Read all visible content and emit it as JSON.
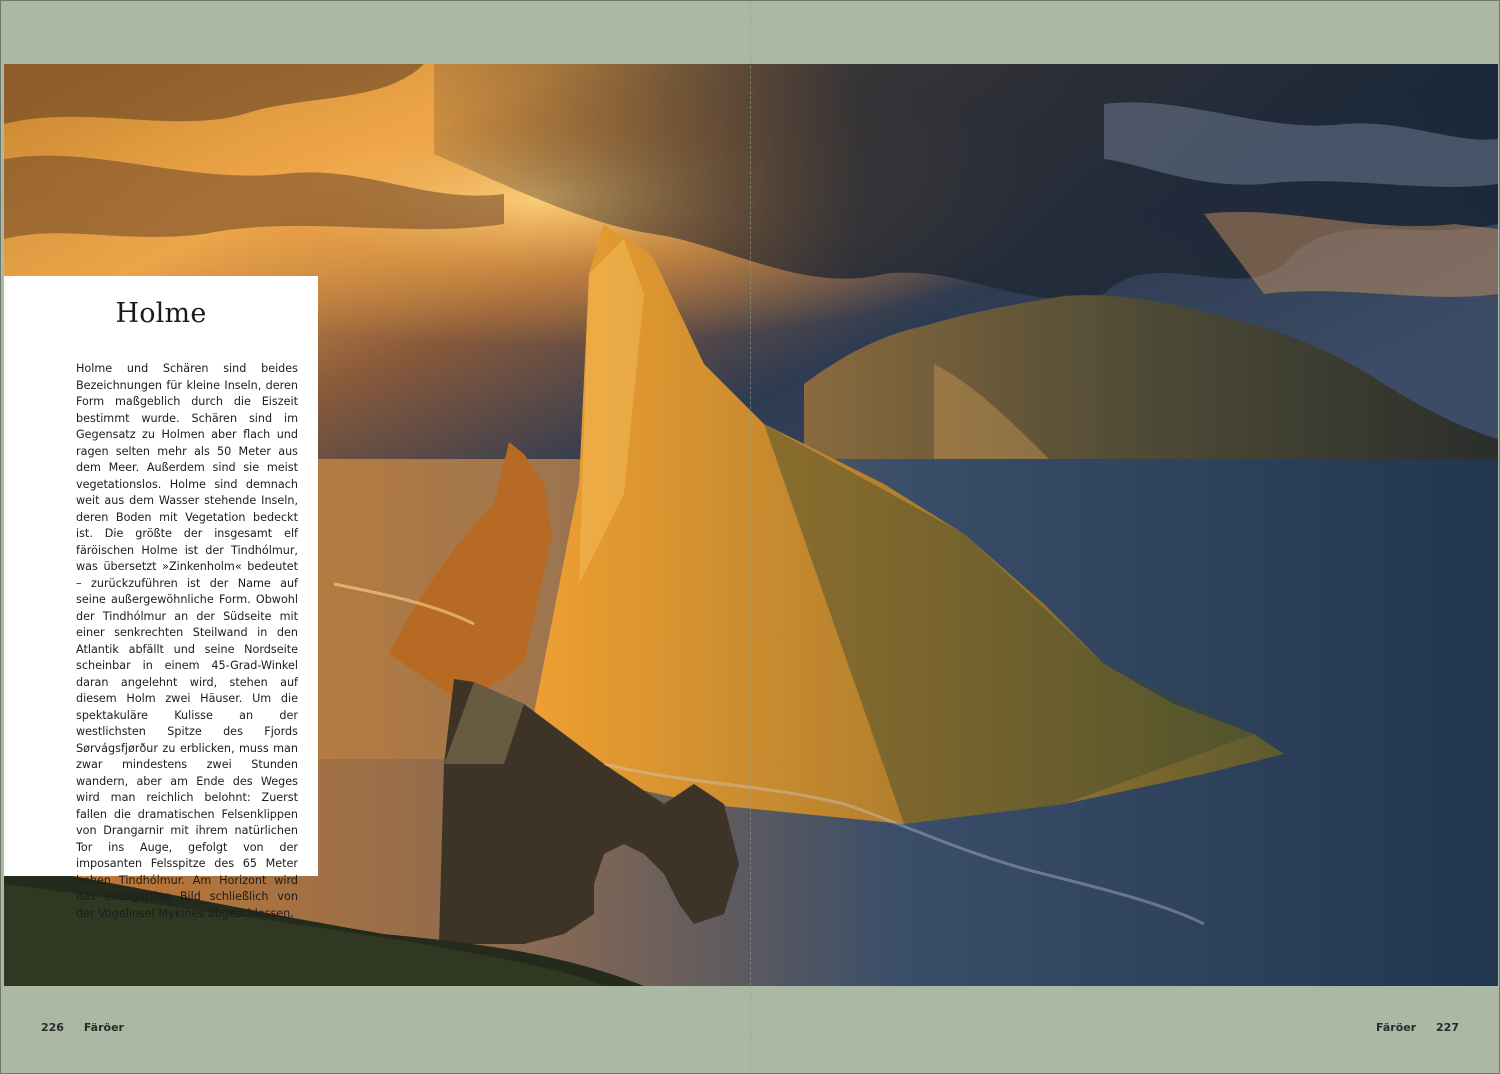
{
  "article": {
    "title": "Holme",
    "body": "Holme und Schären sind beides Bezeichnungen für kleine Inseln, deren Form maßgeblich durch die Eiszeit bestimmt wurde. Schären sind im Gegensatz zu Holmen aber flach und ragen selten mehr als 50 Meter aus dem Meer. Außerdem sind sie meist vegetationslos. Holme sind demnach weit aus dem Wasser stehende Inseln, deren Boden mit Vegetation bedeckt ist. Die größte der insgesamt elf färöischen Holme ist der Tindhólmur, was übersetzt »Zinkenholm« bedeutet – zurückzuführen ist der Name auf seine außergewöhnliche Form. Obwohl der Tindhólmur an der Südseite mit einer senkrechten Steilwand in den Atlantik abfällt und seine Nordseite scheinbar in einem 45-Grad-Winkel daran angelehnt wird, stehen auf diesem Holm zwei Häuser. Um die spektakuläre Kulisse an der westlichsten Spitze des Fjords Sørvágsfjørður zu erblicken, muss man zwar mindestens zwei Stunden wandern, aber am Ende des Weges wird man reichlich belohnt: Zuerst fallen die dramatischen Felsenklippen von Drangarnir mit ihrem natürlichen Tor ins Auge, gefolgt von der imposanten Felsspitze des 65 Meter hohen Tindhólmur. Am Horizont wird das einzigartige Bild schließlich von der Vogelinsel Mykines abgeschlossen."
  },
  "footer": {
    "left_page_number": "226",
    "left_section": "Färöer",
    "right_section": "Färöer",
    "right_page_number": "227"
  },
  "colors": {
    "page_band": "#aab8a4",
    "sea": "#2a3f5c",
    "sunlight": "#f2a43a"
  }
}
